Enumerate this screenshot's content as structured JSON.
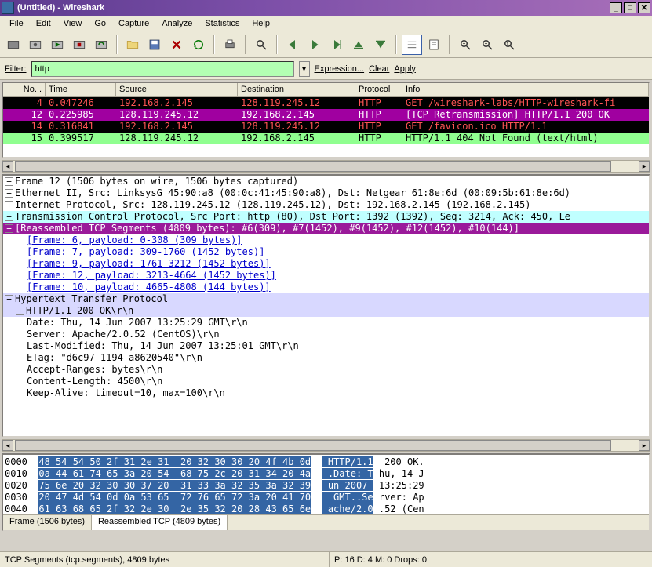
{
  "window": {
    "title": "(Untitled) - Wireshark"
  },
  "menus": [
    "File",
    "Edit",
    "View",
    "Go",
    "Capture",
    "Analyze",
    "Statistics",
    "Help"
  ],
  "filter": {
    "label": "Filter:",
    "value": "http",
    "expression": "Expression...",
    "clear": "Clear",
    "apply": "Apply"
  },
  "packet_columns": {
    "no": "No. .",
    "time": "Time",
    "source": "Source",
    "destination": "Destination",
    "protocol": "Protocol",
    "info": "Info"
  },
  "packets": [
    {
      "no": "4",
      "time": "0.047246",
      "src": "192.168.2.145",
      "dst": "128.119.245.12",
      "proto": "HTTP",
      "info": "GET /wireshark-labs/HTTP-wireshark-fi",
      "bg": "#000000",
      "fg": "#ff5555"
    },
    {
      "no": "12",
      "time": "0.225985",
      "src": "128.119.245.12",
      "dst": "192.168.2.145",
      "proto": "HTTP",
      "info": "[TCP Retransmission] HTTP/1.1 200 OK",
      "bg": "#a000a0",
      "fg": "#ffffff"
    },
    {
      "no": "14",
      "time": "0.316841",
      "src": "192.168.2.145",
      "dst": "128.119.245.12",
      "proto": "HTTP",
      "info": "GET /favicon.ico HTTP/1.1",
      "bg": "#000000",
      "fg": "#ff5555"
    },
    {
      "no": "15",
      "time": "0.399517",
      "src": "128.119.245.12",
      "dst": "192.168.2.145",
      "proto": "HTTP",
      "info": "HTTP/1.1 404 Not Found (text/html)",
      "bg": "#90ff90",
      "fg": "#000000"
    }
  ],
  "details": {
    "frame": "Frame 12 (1506 bytes on wire, 1506 bytes captured)",
    "eth": "Ethernet II, Src: LinksysG_45:90:a8 (00:0c:41:45:90:a8), Dst: Netgear_61:8e:6d (00:09:5b:61:8e:6d)",
    "ip": "Internet Protocol, Src: 128.119.245.12 (128.119.245.12), Dst: 192.168.2.145 (192.168.2.145)",
    "tcp": "Transmission Control Protocol, Src Port: http (80), Dst Port: 1392 (1392), Seq: 3214, Ack: 450, Le",
    "reasm": "[Reassembled TCP Segments (4809 bytes): #6(309), #7(1452), #9(1452), #12(1452), #10(144)]",
    "frames": [
      "[Frame: 6, payload: 0-308 (309 bytes)]",
      "[Frame: 7, payload: 309-1760 (1452 bytes)]",
      "[Frame: 9, payload: 1761-3212 (1452 bytes)]",
      "[Frame: 12, payload: 3213-4664 (1452 bytes)]",
      "[Frame: 10, payload: 4665-4808 (144 bytes)]"
    ],
    "http_root": "Hypertext Transfer Protocol",
    "http_status": "HTTP/1.1 200 OK\\r\\n",
    "http_lines": [
      "Date: Thu, 14 Jun 2007 13:25:29 GMT\\r\\n",
      "Server: Apache/2.0.52 (CentOS)\\r\\n",
      "Last-Modified: Thu, 14 Jun 2007 13:25:01 GMT\\r\\n",
      "ETag: \"d6c97-1194-a8620540\"\\r\\n",
      "Accept-Ranges: bytes\\r\\n",
      "Content-Length: 4500\\r\\n",
      "Keep-Alive: timeout=10, max=100\\r\\n"
    ]
  },
  "hex": [
    {
      "off": "0000",
      "bytes": "48 54 54 50 2f 31 2e 31  20 32 30 30 20 4f 4b 0d",
      "asciiA": " HTTP/1.1",
      "asciiB": "  200 OK."
    },
    {
      "off": "0010",
      "bytes": "0a 44 61 74 65 3a 20 54  68 75 2c 20 31 34 20 4a",
      "asciiA": " .Date: T",
      "asciiB": " hu, 14 J"
    },
    {
      "off": "0020",
      "bytes": "75 6e 20 32 30 30 37 20  31 33 3a 32 35 3a 32 39",
      "asciiA": " un 2007 ",
      "asciiB": " 13:25:29"
    },
    {
      "off": "0030",
      "bytes": "20 47 4d 54 0d 0a 53 65  72 76 65 72 3a 20 41 70",
      "asciiA": "  GMT..Se",
      "asciiB": " rver: Ap"
    },
    {
      "off": "0040",
      "bytes": "61 63 68 65 2f 32 2e 30  2e 35 32 20 28 43 65 6e",
      "asciiA": " ache/2.0",
      "asciiB": " .52 (Cen"
    }
  ],
  "hex_tabs": {
    "t1": "Frame (1506 bytes)",
    "t2": "Reassembled TCP (4809 bytes)"
  },
  "status": {
    "left": "TCP Segments (tcp.segments), 4809 bytes",
    "right": "P: 16 D: 4 M: 0 Drops: 0"
  }
}
